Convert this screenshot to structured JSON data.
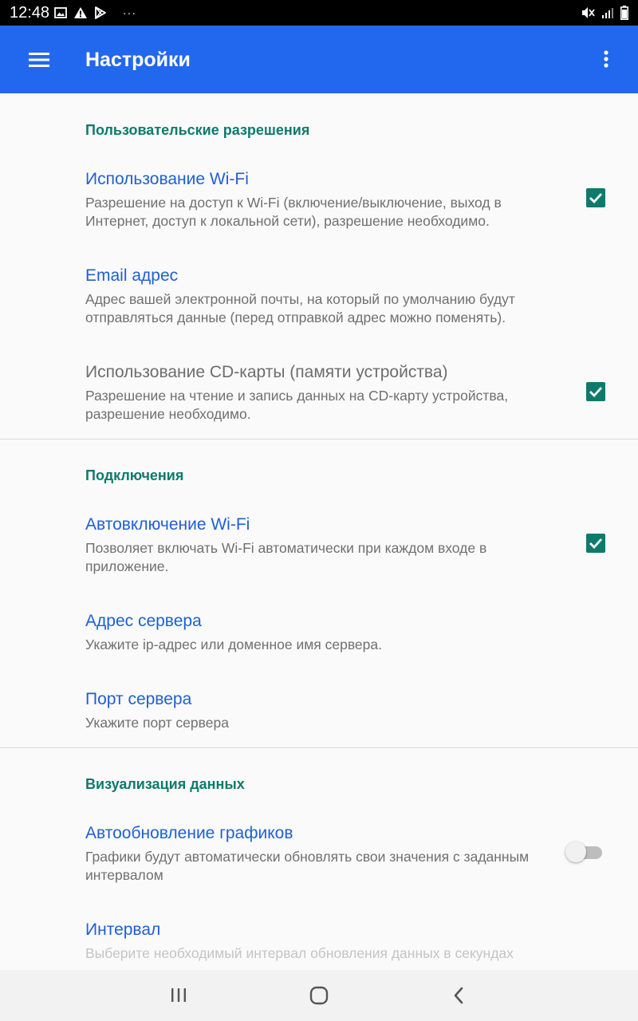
{
  "status_bar": {
    "time": "12:48",
    "left_icons": [
      "image-icon",
      "warning-icon",
      "play-store-icon",
      "more-notifications-icon"
    ],
    "right_icons": [
      "mute-icon",
      "signal-icon",
      "battery-icon"
    ],
    "more_glyph": "···"
  },
  "app_bar": {
    "title": "Настройки",
    "color": "#2268ee"
  },
  "categories": {
    "permissions": "Пользовательские разрешения",
    "connections": "Подключения",
    "visualization": "Визуализация данных"
  },
  "prefs": {
    "wifi_usage": {
      "title": "Использование Wi-Fi",
      "summary": "Разрешение на доступ к Wi-Fi (включение/выключение, выход в Интернет, доступ к локальной сети), разрешение необходимо.",
      "checked": true
    },
    "email": {
      "title": "Email адрес",
      "summary": "Адрес вашей электронной почты, на который по умолчанию будут отправляться данные (перед отправкой адрес можно поменять)."
    },
    "sd_card": {
      "title": "Использование СD-карты (памяти устройства)",
      "summary": "Разрешение на чтение и запись данных на СD-карту устройства, разрешение необходимо.",
      "checked": true
    },
    "wifi_auto": {
      "title": "Автовключение Wi-Fi",
      "summary": "Позволяет включать Wi-Fi автоматически при каждом входе в приложение.",
      "checked": true
    },
    "server_address": {
      "title": "Адрес сервера",
      "summary": "Укажите ip-адрес или доменное имя сервера."
    },
    "server_port": {
      "title": "Порт сервера",
      "summary": "Укажите порт сервера"
    },
    "charts_autoupdate": {
      "title": "Автообновление графиков",
      "summary": "Графики будут автоматически обновлять свои значения с заданным интервалом",
      "enabled": false
    },
    "interval": {
      "title": "Интервал",
      "summary": "Выберите необходимый интервал обновления данных в секундах"
    }
  },
  "colors": {
    "accent": "#0e7a6c",
    "title_blue": "#1f5fd6"
  }
}
